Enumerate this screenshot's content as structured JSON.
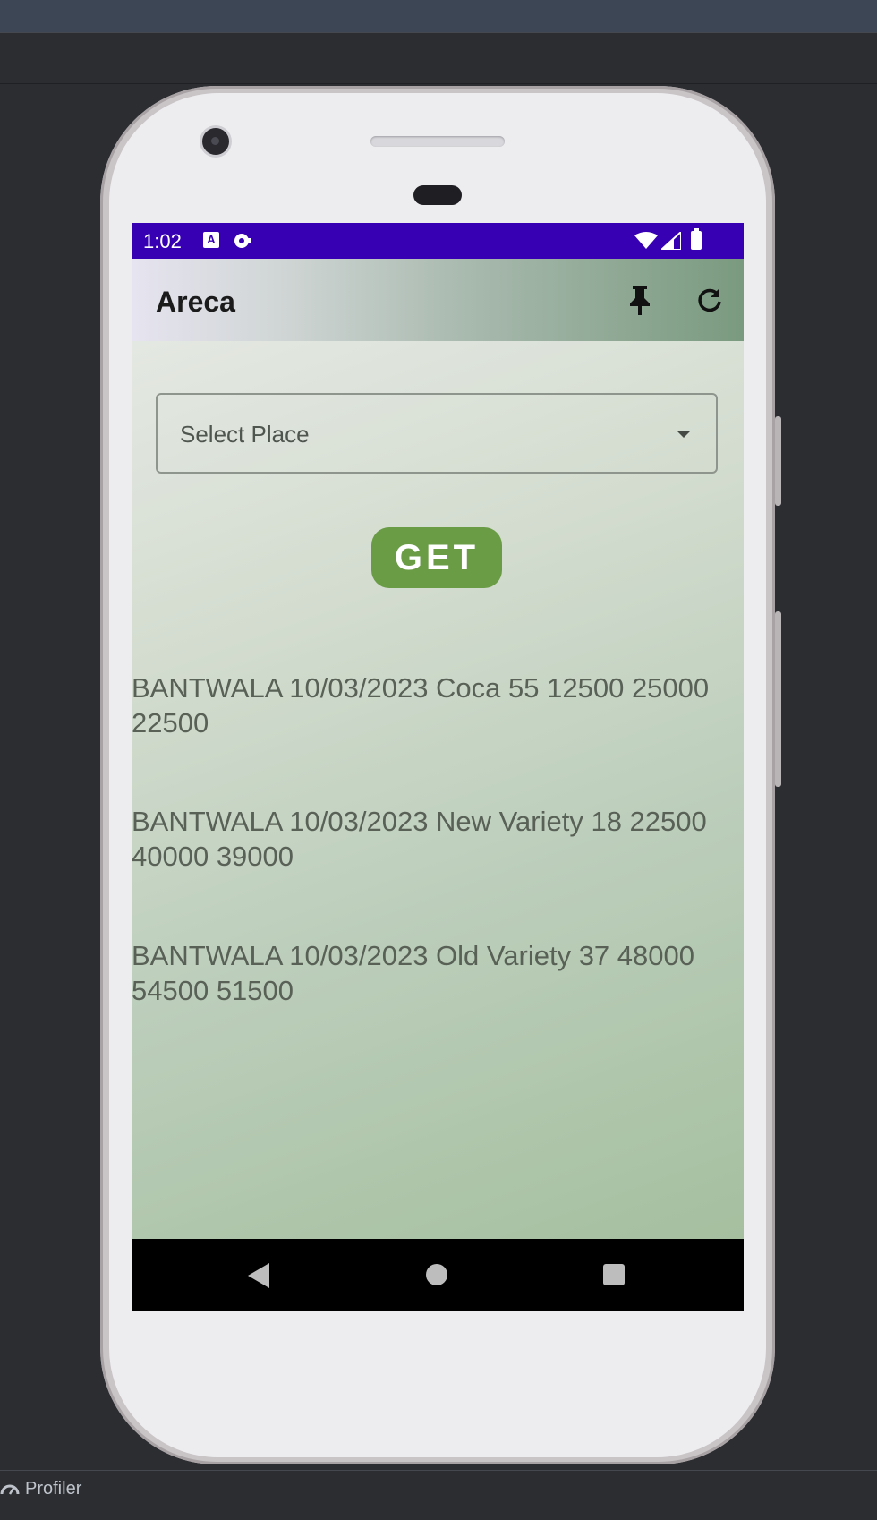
{
  "ide": {
    "bottom_tool": "Profiler"
  },
  "status_bar": {
    "time": "1:02",
    "notification_icons": [
      "accessibility-icon",
      "sync-icon"
    ],
    "system_icons": [
      "wifi-icon",
      "signal-icon",
      "battery-icon"
    ]
  },
  "app_bar": {
    "title": "Areca",
    "actions": [
      "pin-icon",
      "refresh-icon"
    ]
  },
  "form": {
    "place_placeholder": "Select Place",
    "get_label": "GET"
  },
  "results": [
    "BANTWALA 10/03/2023 Coca 55 12500 25000 22500",
    "BANTWALA 10/03/2023 New Variety 18 22500 40000 39000",
    "BANTWALA 10/03/2023 Old Variety 37 48000 54500 51500"
  ],
  "nav_bar": {
    "buttons": [
      "back-icon",
      "home-icon",
      "recents-icon"
    ]
  },
  "colors": {
    "status_bar": "#3700b3",
    "get_button": "#6a9b45",
    "nav_bar": "#000000"
  }
}
